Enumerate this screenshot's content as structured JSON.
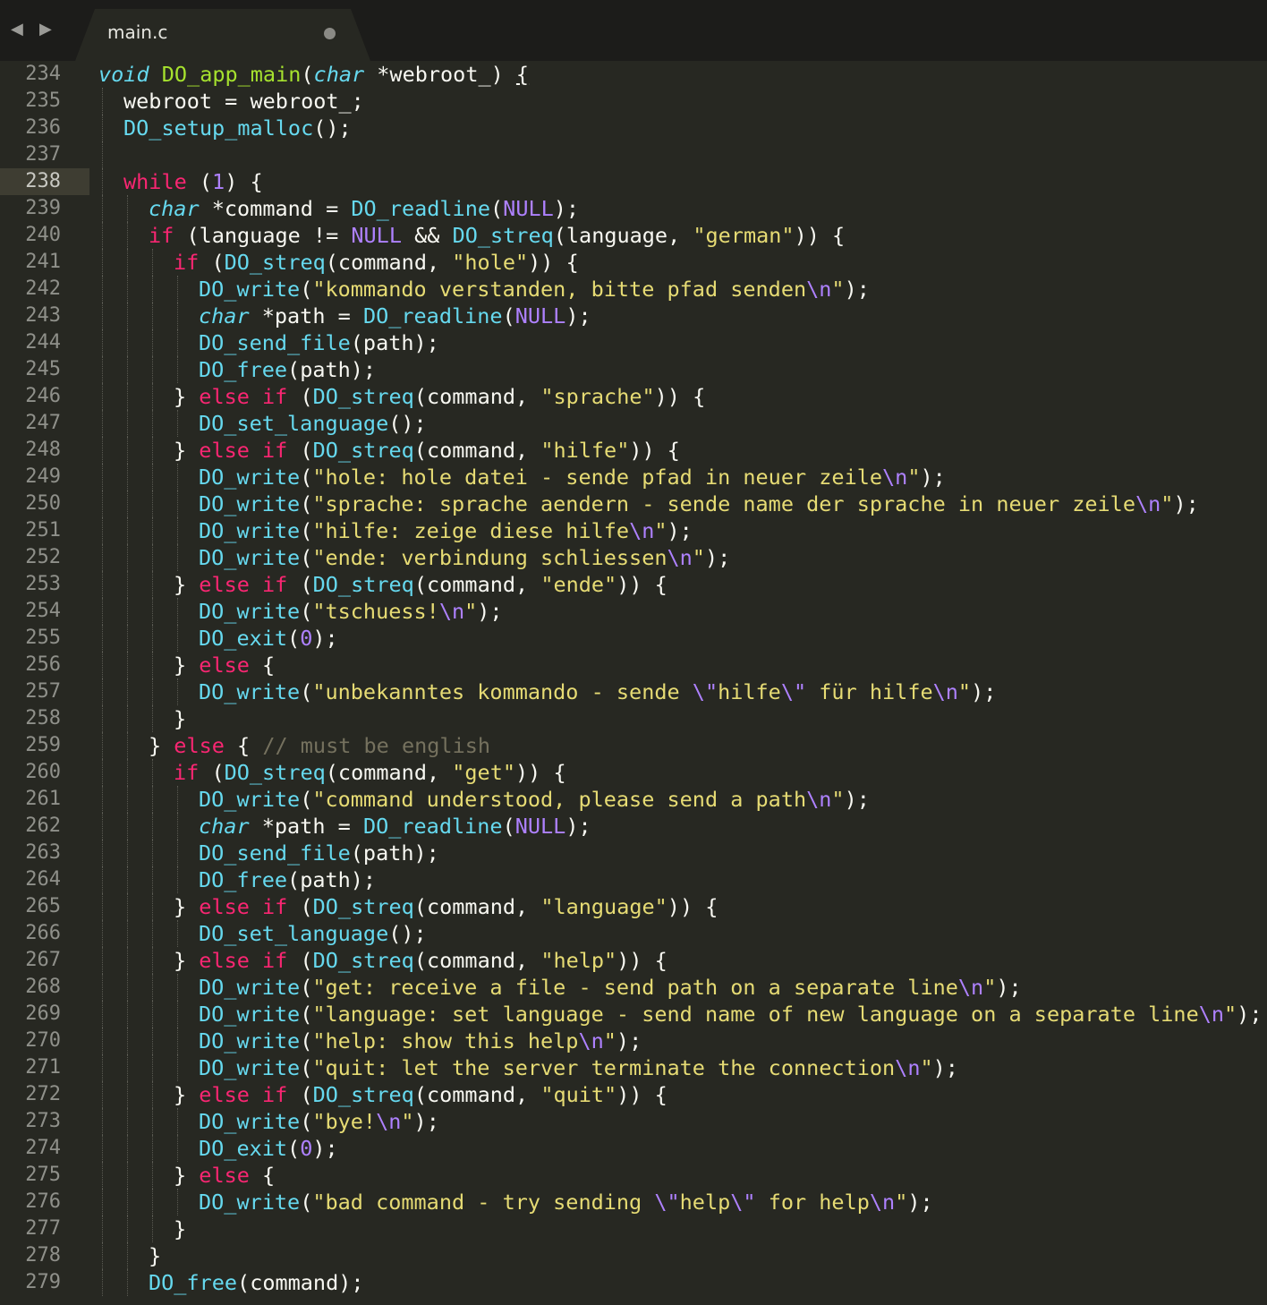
{
  "tab": {
    "title": "main.c"
  },
  "nav": {
    "back": "◀",
    "forward": "▶"
  },
  "current_line": 238,
  "lines": [
    {
      "n": "234",
      "i": 0,
      "t": [
        [
          "t",
          "void"
        ],
        [
          "p",
          " "
        ],
        [
          "f",
          "DO_app_main"
        ],
        [
          "p",
          "("
        ],
        [
          "t",
          "char"
        ],
        [
          "p",
          " *webroot_) "
        ],
        [
          "u",
          "{"
        ]
      ]
    },
    {
      "n": "235",
      "i": 1,
      "t": [
        [
          "p",
          "webroot = webroot_;"
        ]
      ]
    },
    {
      "n": "236",
      "i": 1,
      "t": [
        [
          "c",
          "DO_setup_malloc"
        ],
        [
          "p",
          "();"
        ]
      ]
    },
    {
      "n": "237",
      "i": 1,
      "t": []
    },
    {
      "n": "238",
      "i": 1,
      "t": [
        [
          "k",
          "while"
        ],
        [
          "p",
          " ("
        ],
        [
          "n",
          "1"
        ],
        [
          "p",
          ") {"
        ]
      ]
    },
    {
      "n": "239",
      "i": 2,
      "t": [
        [
          "t",
          "char"
        ],
        [
          "p",
          " *command = "
        ],
        [
          "c",
          "DO_readline"
        ],
        [
          "p",
          "("
        ],
        [
          "n",
          "NULL"
        ],
        [
          "p",
          ");"
        ]
      ]
    },
    {
      "n": "240",
      "i": 2,
      "t": [
        [
          "k",
          "if"
        ],
        [
          "p",
          " (language != "
        ],
        [
          "n",
          "NULL"
        ],
        [
          "p",
          " && "
        ],
        [
          "c",
          "DO_streq"
        ],
        [
          "p",
          "(language, "
        ],
        [
          "s",
          "\"german\""
        ],
        [
          "p",
          ")) {"
        ]
      ]
    },
    {
      "n": "241",
      "i": 3,
      "t": [
        [
          "k",
          "if"
        ],
        [
          "p",
          " ("
        ],
        [
          "c",
          "DO_streq"
        ],
        [
          "p",
          "(command, "
        ],
        [
          "s",
          "\"hole\""
        ],
        [
          "p",
          ")) {"
        ]
      ]
    },
    {
      "n": "242",
      "i": 4,
      "t": [
        [
          "c",
          "DO_write"
        ],
        [
          "p",
          "("
        ],
        [
          "s",
          "\"kommando verstanden, bitte pfad senden"
        ],
        [
          "e",
          "\\n"
        ],
        [
          "s",
          "\""
        ],
        [
          "p",
          ");"
        ]
      ]
    },
    {
      "n": "243",
      "i": 4,
      "t": [
        [
          "t",
          "char"
        ],
        [
          "p",
          " *path = "
        ],
        [
          "c",
          "DO_readline"
        ],
        [
          "p",
          "("
        ],
        [
          "n",
          "NULL"
        ],
        [
          "p",
          ");"
        ]
      ]
    },
    {
      "n": "244",
      "i": 4,
      "t": [
        [
          "c",
          "DO_send_file"
        ],
        [
          "p",
          "(path);"
        ]
      ]
    },
    {
      "n": "245",
      "i": 4,
      "t": [
        [
          "c",
          "DO_free"
        ],
        [
          "p",
          "(path);"
        ]
      ]
    },
    {
      "n": "246",
      "i": 3,
      "t": [
        [
          "p",
          "} "
        ],
        [
          "k",
          "else if"
        ],
        [
          "p",
          " ("
        ],
        [
          "c",
          "DO_streq"
        ],
        [
          "p",
          "(command, "
        ],
        [
          "s",
          "\"sprache\""
        ],
        [
          "p",
          ")) {"
        ]
      ]
    },
    {
      "n": "247",
      "i": 4,
      "t": [
        [
          "c",
          "DO_set_language"
        ],
        [
          "p",
          "();"
        ]
      ]
    },
    {
      "n": "248",
      "i": 3,
      "t": [
        [
          "p",
          "} "
        ],
        [
          "k",
          "else if"
        ],
        [
          "p",
          " ("
        ],
        [
          "c",
          "DO_streq"
        ],
        [
          "p",
          "(command, "
        ],
        [
          "s",
          "\"hilfe\""
        ],
        [
          "p",
          ")) {"
        ]
      ]
    },
    {
      "n": "249",
      "i": 4,
      "t": [
        [
          "c",
          "DO_write"
        ],
        [
          "p",
          "("
        ],
        [
          "s",
          "\"hole: hole datei - sende pfad in neuer zeile"
        ],
        [
          "e",
          "\\n"
        ],
        [
          "s",
          "\""
        ],
        [
          "p",
          ");"
        ]
      ]
    },
    {
      "n": "250",
      "i": 4,
      "t": [
        [
          "c",
          "DO_write"
        ],
        [
          "p",
          "("
        ],
        [
          "s",
          "\"sprache: sprache aendern - sende name der sprache in neuer zeile"
        ],
        [
          "e",
          "\\n"
        ],
        [
          "s",
          "\""
        ],
        [
          "p",
          ");"
        ]
      ]
    },
    {
      "n": "251",
      "i": 4,
      "t": [
        [
          "c",
          "DO_write"
        ],
        [
          "p",
          "("
        ],
        [
          "s",
          "\"hilfe: zeige diese hilfe"
        ],
        [
          "e",
          "\\n"
        ],
        [
          "s",
          "\""
        ],
        [
          "p",
          ");"
        ]
      ]
    },
    {
      "n": "252",
      "i": 4,
      "t": [
        [
          "c",
          "DO_write"
        ],
        [
          "p",
          "("
        ],
        [
          "s",
          "\"ende: verbindung schliessen"
        ],
        [
          "e",
          "\\n"
        ],
        [
          "s",
          "\""
        ],
        [
          "p",
          ");"
        ]
      ]
    },
    {
      "n": "253",
      "i": 3,
      "t": [
        [
          "p",
          "} "
        ],
        [
          "k",
          "else if"
        ],
        [
          "p",
          " ("
        ],
        [
          "c",
          "DO_streq"
        ],
        [
          "p",
          "(command, "
        ],
        [
          "s",
          "\"ende\""
        ],
        [
          "p",
          ")) {"
        ]
      ]
    },
    {
      "n": "254",
      "i": 4,
      "t": [
        [
          "c",
          "DO_write"
        ],
        [
          "p",
          "("
        ],
        [
          "s",
          "\"tschuess!"
        ],
        [
          "e",
          "\\n"
        ],
        [
          "s",
          "\""
        ],
        [
          "p",
          ");"
        ]
      ]
    },
    {
      "n": "255",
      "i": 4,
      "t": [
        [
          "c",
          "DO_exit"
        ],
        [
          "p",
          "("
        ],
        [
          "n",
          "0"
        ],
        [
          "p",
          ");"
        ]
      ]
    },
    {
      "n": "256",
      "i": 3,
      "t": [
        [
          "p",
          "} "
        ],
        [
          "k",
          "else"
        ],
        [
          "p",
          " {"
        ]
      ]
    },
    {
      "n": "257",
      "i": 4,
      "t": [
        [
          "c",
          "DO_write"
        ],
        [
          "p",
          "("
        ],
        [
          "s",
          "\"unbekanntes kommando - sende "
        ],
        [
          "e",
          "\\\""
        ],
        [
          "s",
          "hilfe"
        ],
        [
          "e",
          "\\\""
        ],
        [
          "s",
          " für hilfe"
        ],
        [
          "e",
          "\\n"
        ],
        [
          "s",
          "\""
        ],
        [
          "p",
          ");"
        ]
      ]
    },
    {
      "n": "258",
      "i": 3,
      "t": [
        [
          "p",
          "}"
        ]
      ]
    },
    {
      "n": "259",
      "i": 2,
      "t": [
        [
          "p",
          "} "
        ],
        [
          "k",
          "else"
        ],
        [
          "p",
          " { "
        ],
        [
          "m",
          "// must be english"
        ]
      ]
    },
    {
      "n": "260",
      "i": 3,
      "t": [
        [
          "k",
          "if"
        ],
        [
          "p",
          " ("
        ],
        [
          "c",
          "DO_streq"
        ],
        [
          "p",
          "(command, "
        ],
        [
          "s",
          "\"get\""
        ],
        [
          "p",
          ")) {"
        ]
      ]
    },
    {
      "n": "261",
      "i": 4,
      "t": [
        [
          "c",
          "DO_write"
        ],
        [
          "p",
          "("
        ],
        [
          "s",
          "\"command understood, please send a path"
        ],
        [
          "e",
          "\\n"
        ],
        [
          "s",
          "\""
        ],
        [
          "p",
          ");"
        ]
      ]
    },
    {
      "n": "262",
      "i": 4,
      "t": [
        [
          "t",
          "char"
        ],
        [
          "p",
          " *path = "
        ],
        [
          "c",
          "DO_readline"
        ],
        [
          "p",
          "("
        ],
        [
          "n",
          "NULL"
        ],
        [
          "p",
          ");"
        ]
      ]
    },
    {
      "n": "263",
      "i": 4,
      "t": [
        [
          "c",
          "DO_send_file"
        ],
        [
          "p",
          "(path);"
        ]
      ]
    },
    {
      "n": "264",
      "i": 4,
      "t": [
        [
          "c",
          "DO_free"
        ],
        [
          "p",
          "(path);"
        ]
      ]
    },
    {
      "n": "265",
      "i": 3,
      "t": [
        [
          "p",
          "} "
        ],
        [
          "k",
          "else if"
        ],
        [
          "p",
          " ("
        ],
        [
          "c",
          "DO_streq"
        ],
        [
          "p",
          "(command, "
        ],
        [
          "s",
          "\"language\""
        ],
        [
          "p",
          ")) {"
        ]
      ]
    },
    {
      "n": "266",
      "i": 4,
      "t": [
        [
          "c",
          "DO_set_language"
        ],
        [
          "p",
          "();"
        ]
      ]
    },
    {
      "n": "267",
      "i": 3,
      "t": [
        [
          "p",
          "} "
        ],
        [
          "k",
          "else if"
        ],
        [
          "p",
          " ("
        ],
        [
          "c",
          "DO_streq"
        ],
        [
          "p",
          "(command, "
        ],
        [
          "s",
          "\"help\""
        ],
        [
          "p",
          ")) {"
        ]
      ]
    },
    {
      "n": "268",
      "i": 4,
      "t": [
        [
          "c",
          "DO_write"
        ],
        [
          "p",
          "("
        ],
        [
          "s",
          "\"get: receive a file - send path on a separate line"
        ],
        [
          "e",
          "\\n"
        ],
        [
          "s",
          "\""
        ],
        [
          "p",
          ");"
        ]
      ]
    },
    {
      "n": "269",
      "i": 4,
      "t": [
        [
          "c",
          "DO_write"
        ],
        [
          "p",
          "("
        ],
        [
          "s",
          "\"language: set language - send name of new language on a separate line"
        ],
        [
          "e",
          "\\n"
        ],
        [
          "s",
          "\""
        ],
        [
          "p",
          ");"
        ]
      ]
    },
    {
      "n": "270",
      "i": 4,
      "t": [
        [
          "c",
          "DO_write"
        ],
        [
          "p",
          "("
        ],
        [
          "s",
          "\"help: show this help"
        ],
        [
          "e",
          "\\n"
        ],
        [
          "s",
          "\""
        ],
        [
          "p",
          ");"
        ]
      ]
    },
    {
      "n": "271",
      "i": 4,
      "t": [
        [
          "c",
          "DO_write"
        ],
        [
          "p",
          "("
        ],
        [
          "s",
          "\"quit: let the server terminate the connection"
        ],
        [
          "e",
          "\\n"
        ],
        [
          "s",
          "\""
        ],
        [
          "p",
          ");"
        ]
      ]
    },
    {
      "n": "272",
      "i": 3,
      "t": [
        [
          "p",
          "} "
        ],
        [
          "k",
          "else if"
        ],
        [
          "p",
          " ("
        ],
        [
          "c",
          "DO_streq"
        ],
        [
          "p",
          "(command, "
        ],
        [
          "s",
          "\"quit\""
        ],
        [
          "p",
          ")) {"
        ]
      ]
    },
    {
      "n": "273",
      "i": 4,
      "t": [
        [
          "c",
          "DO_write"
        ],
        [
          "p",
          "("
        ],
        [
          "s",
          "\"bye!"
        ],
        [
          "e",
          "\\n"
        ],
        [
          "s",
          "\""
        ],
        [
          "p",
          ");"
        ]
      ]
    },
    {
      "n": "274",
      "i": 4,
      "t": [
        [
          "c",
          "DO_exit"
        ],
        [
          "p",
          "("
        ],
        [
          "n",
          "0"
        ],
        [
          "p",
          ");"
        ]
      ]
    },
    {
      "n": "275",
      "i": 3,
      "t": [
        [
          "p",
          "} "
        ],
        [
          "k",
          "else"
        ],
        [
          "p",
          " {"
        ]
      ]
    },
    {
      "n": "276",
      "i": 4,
      "t": [
        [
          "c",
          "DO_write"
        ],
        [
          "p",
          "("
        ],
        [
          "s",
          "\"bad command - try sending "
        ],
        [
          "e",
          "\\\""
        ],
        [
          "s",
          "help"
        ],
        [
          "e",
          "\\\""
        ],
        [
          "s",
          " for help"
        ],
        [
          "e",
          "\\n"
        ],
        [
          "s",
          "\""
        ],
        [
          "p",
          ");"
        ]
      ]
    },
    {
      "n": "277",
      "i": 3,
      "t": [
        [
          "p",
          "}"
        ]
      ]
    },
    {
      "n": "278",
      "i": 2,
      "t": [
        [
          "p",
          "}"
        ]
      ]
    },
    {
      "n": "279",
      "i": 2,
      "t": [
        [
          "c",
          "DO_free"
        ],
        [
          "p",
          "(command);"
        ]
      ]
    }
  ]
}
